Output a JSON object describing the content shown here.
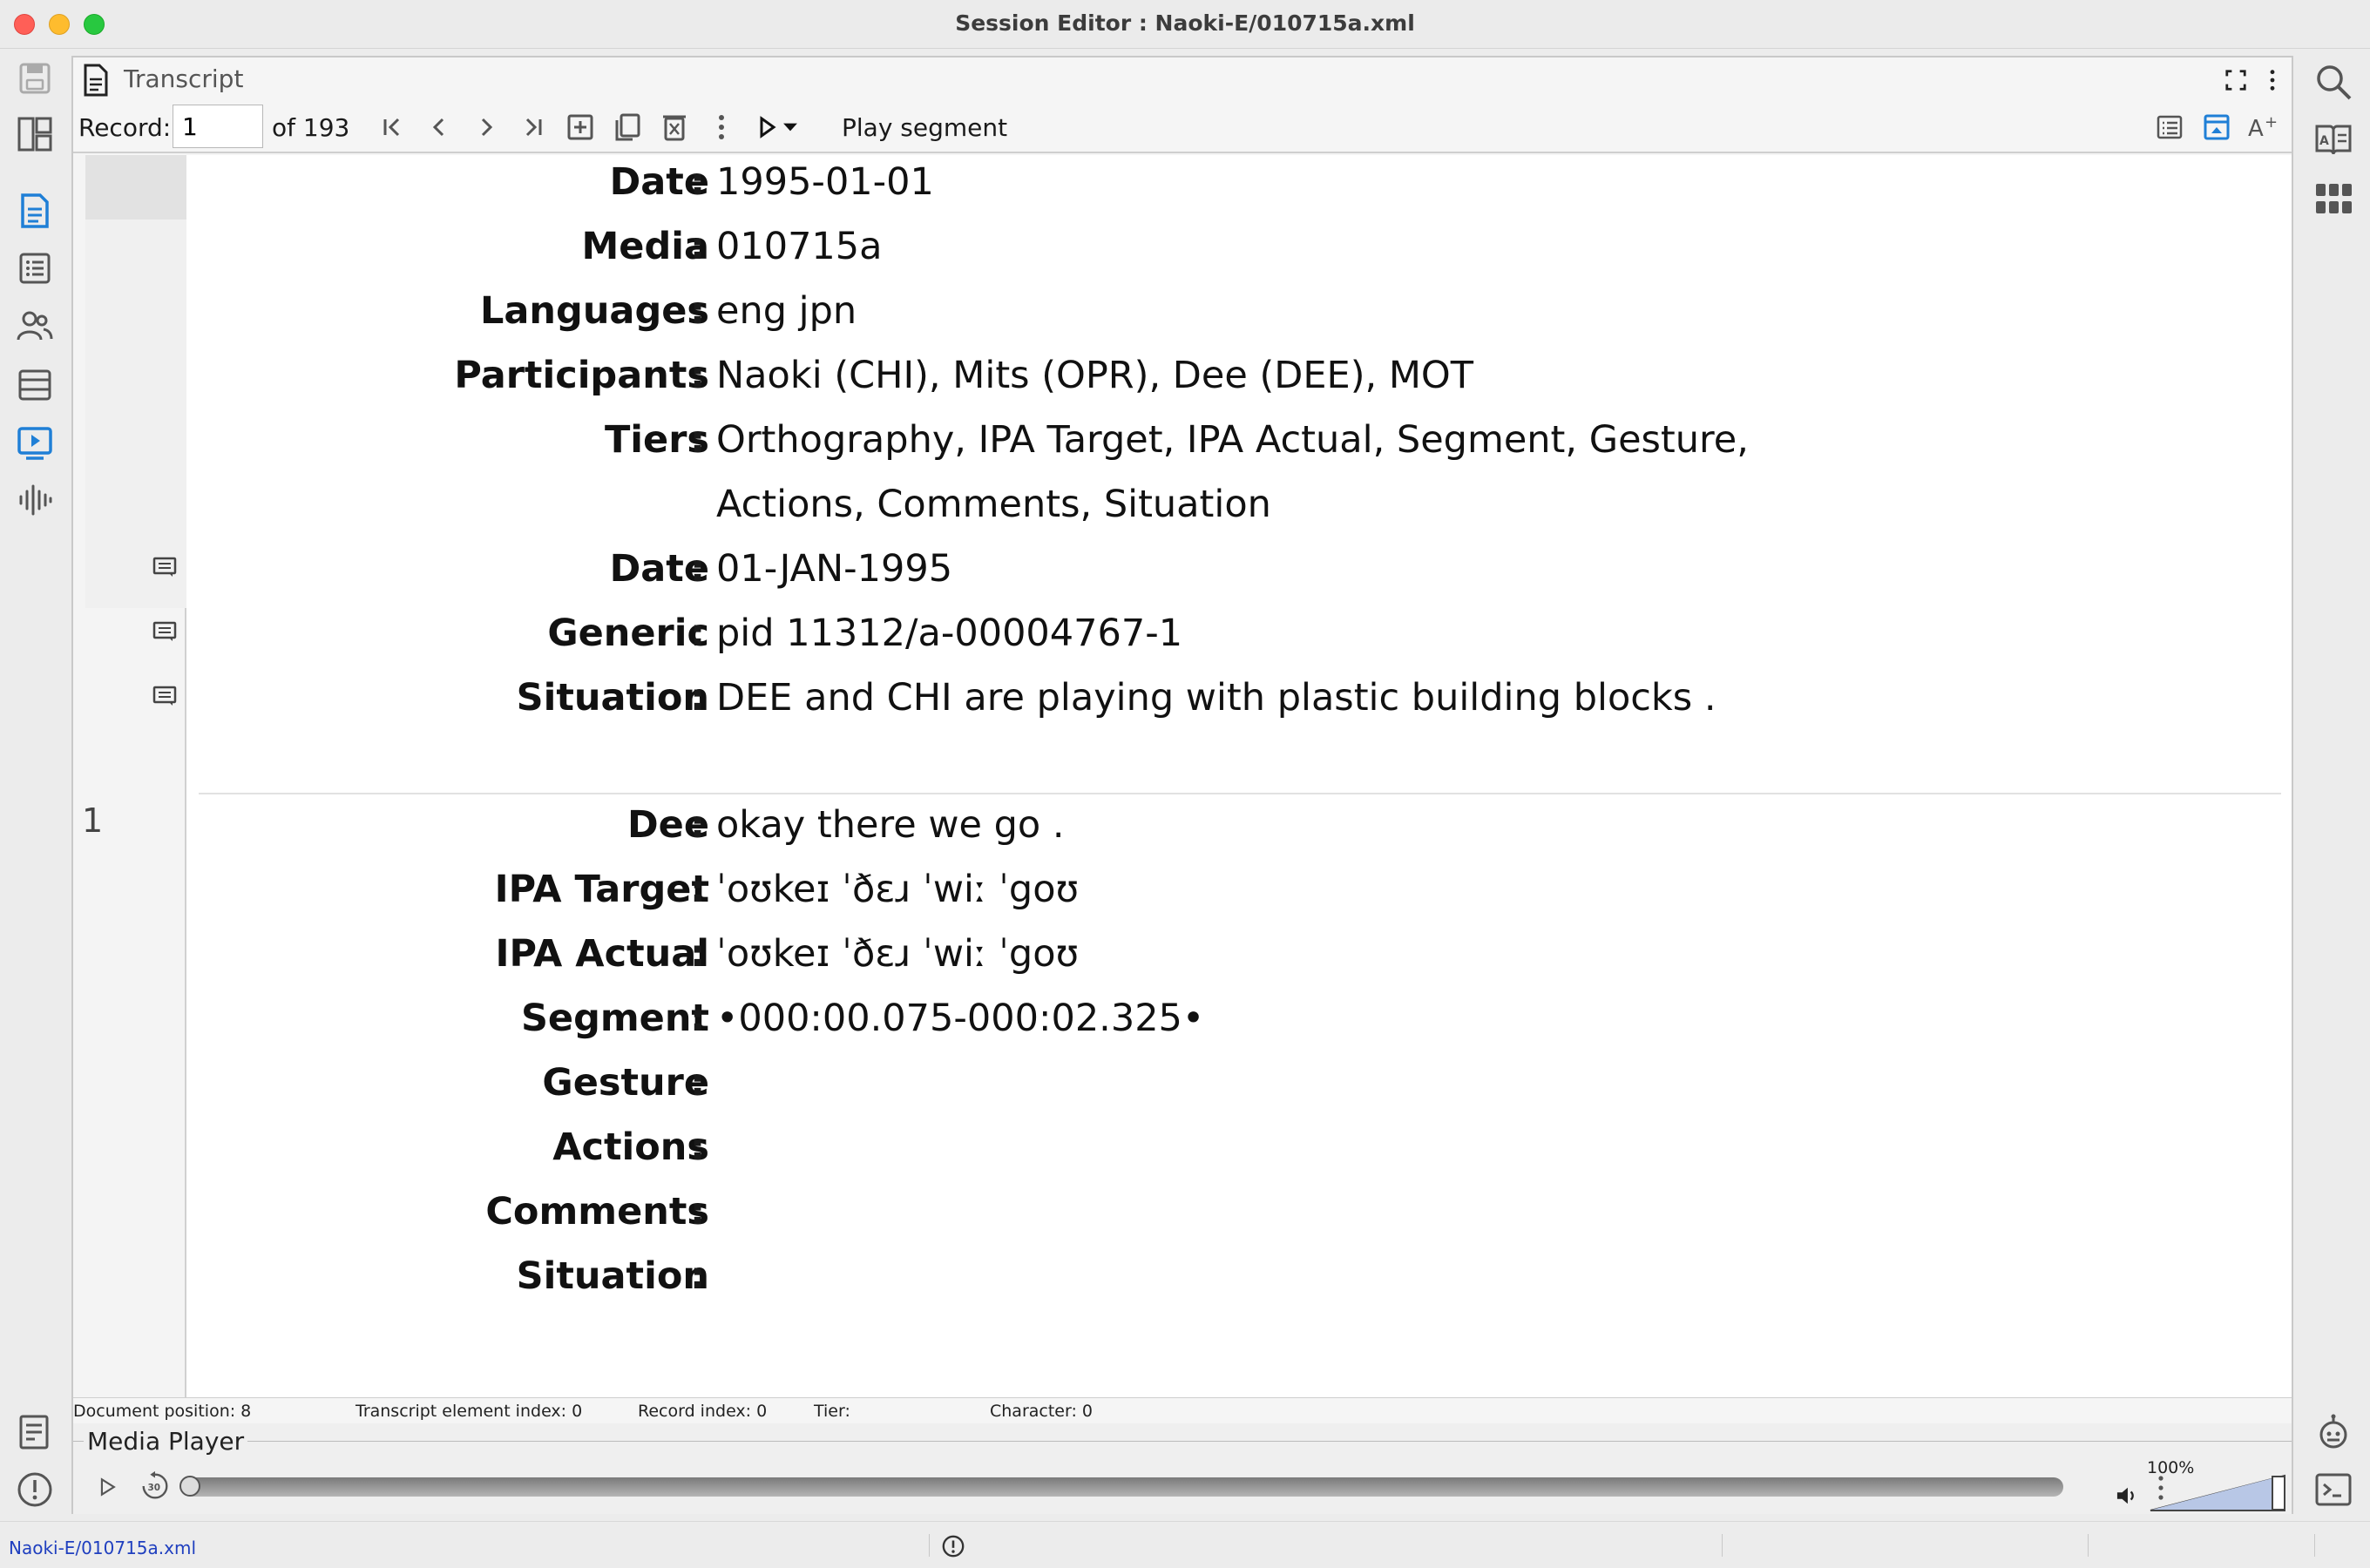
{
  "window": {
    "title": "Session Editor : Naoki-E/010715a.xml"
  },
  "panel": {
    "title": "Transcript"
  },
  "toolbar": {
    "record_label": "Record:",
    "record_value": "1",
    "of_label": "of 193",
    "play_label": "Play segment"
  },
  "header_lines": [
    {
      "label": "Date",
      "value": "1995-01-01"
    },
    {
      "label": "Media",
      "value": "010715a"
    },
    {
      "label": "Languages",
      "value": "eng jpn"
    },
    {
      "label": "Participants",
      "value": "Naoki (CHI), Mits (OPR), Dee (DEE), MOT"
    },
    {
      "label": "Tiers",
      "value": "Orthography, IPA Target, IPA Actual, Segment, Gesture,"
    },
    {
      "label": "",
      "value": "Actions, Comments, Situation"
    },
    {
      "label": "Date",
      "value": "01-JAN-1995"
    },
    {
      "label": "Generic",
      "value": "pid 11312/a-00004767-1"
    },
    {
      "label": "Situation",
      "value": "DEE and CHI are playing with plastic building blocks ."
    }
  ],
  "record": {
    "number": "1",
    "tiers": [
      {
        "label": "Dee",
        "value": "okay there we go ."
      },
      {
        "label": "IPA Target",
        "value": "ˈoʊkeɪ ˈðɛɹ ˈwiː ˈgoʊ"
      },
      {
        "label": "IPA Actual",
        "value": "ˈoʊkeɪ ˈðɛɹ ˈwiː ˈgoʊ"
      },
      {
        "label": "Segment",
        "value": "•000:00.075-000:02.325•"
      },
      {
        "label": "Gesture",
        "value": ""
      },
      {
        "label": "Actions",
        "value": ""
      },
      {
        "label": "Comments",
        "value": ""
      },
      {
        "label": "Situation",
        "value": ""
      }
    ]
  },
  "status": {
    "doc_position": "Document position: 8",
    "element_index": "Transcript element index: 0",
    "record_index": "Record index: 0",
    "tier": "Tier:",
    "character": "Character: 0"
  },
  "media_player": {
    "title": "Media Player",
    "volume": "100%",
    "volume_level": 1.0,
    "position_fraction": 0.0
  },
  "bottom": {
    "file": "Naoki-E/010715a.xml"
  },
  "colors": {
    "accent": "#1f7fd6",
    "link": "#1f3fbf"
  }
}
